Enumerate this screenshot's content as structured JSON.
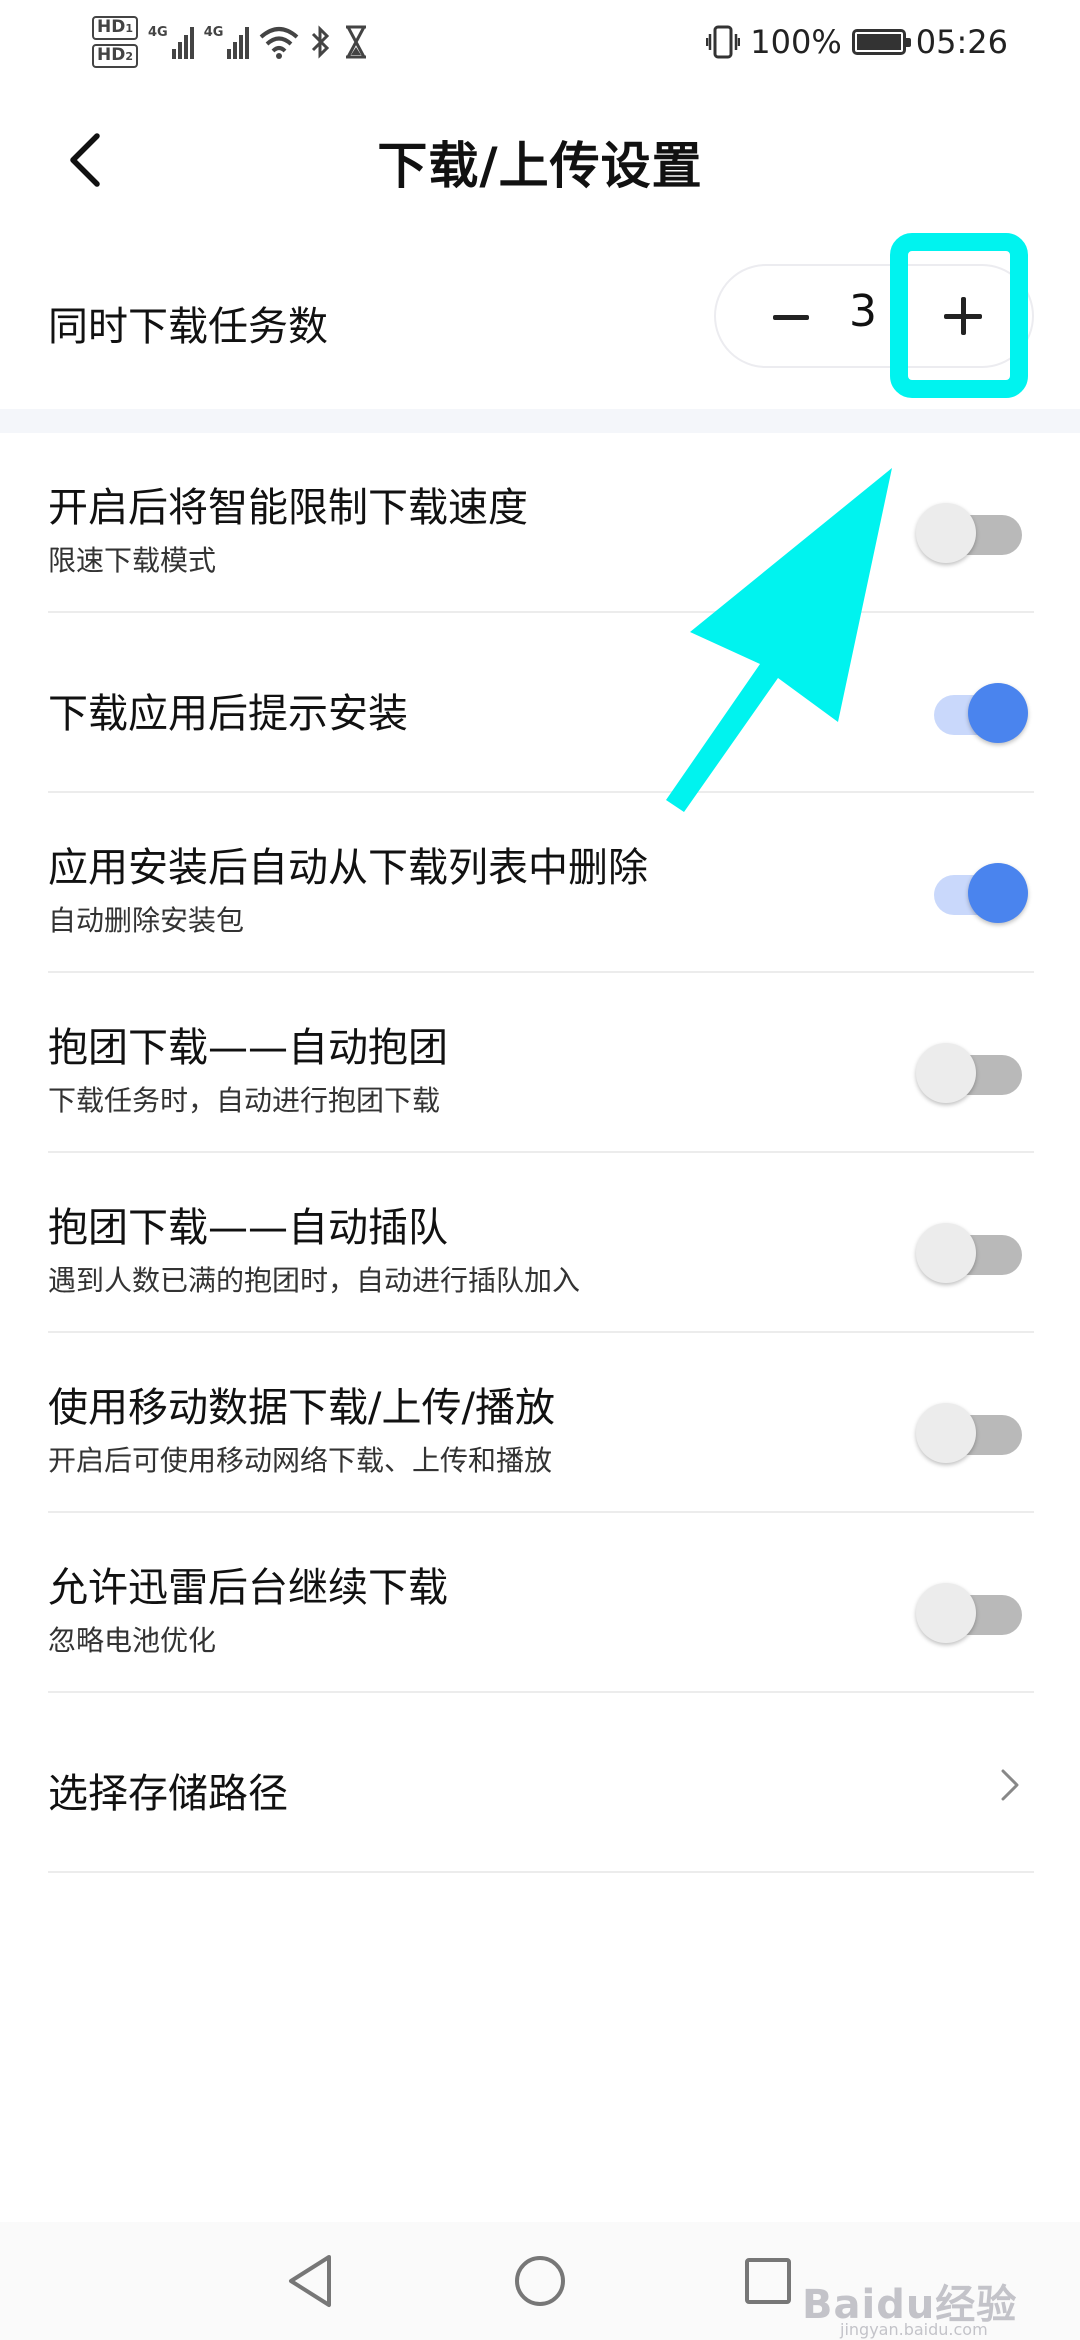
{
  "status_bar": {
    "hd1": "HD",
    "hd1_sub": "1",
    "hd2": "HD",
    "hd2_sub": "2",
    "network1": "4G",
    "network2": "4G",
    "battery_percent": "100%",
    "battery_level": 1.0,
    "time": "05:26",
    "icons": [
      "signal-icon",
      "wifi-icon",
      "bluetooth-icon",
      "hourglass-icon",
      "vibrate-icon",
      "battery-icon"
    ]
  },
  "header": {
    "title": "下载/上传设置",
    "back_icon": "back-arrow-icon"
  },
  "concurrent_tasks": {
    "label": "同时下载任务数",
    "value": "3"
  },
  "settings": [
    {
      "title": "开启后将智能限制下载速度",
      "subtitle": "限速下载模式",
      "enabled": false
    },
    {
      "title": "下载应用后提示安装",
      "subtitle": "",
      "enabled": true
    },
    {
      "title": "应用安装后自动从下载列表中删除",
      "subtitle": "自动删除安装包",
      "enabled": true
    },
    {
      "title": "抱团下载——自动抱团",
      "subtitle": "下载任务时，自动进行抱团下载",
      "enabled": false
    },
    {
      "title": "抱团下载——自动插队",
      "subtitle": "遇到人数已满的抱团时，自动进行插队加入",
      "enabled": false
    },
    {
      "title": "使用移动数据下载/上传/播放",
      "subtitle": "开启后可使用移动网络下载、上传和播放",
      "enabled": false
    },
    {
      "title": "允许迅雷后台继续下载",
      "subtitle": "忽略电池优化",
      "enabled": false
    }
  ],
  "storage": {
    "label": "选择存储路径"
  },
  "colors": {
    "accent": "#4a84ee",
    "accent_track": "#c9d8fb",
    "annotation": "#00f3ef",
    "divider": "#ececec",
    "section_bg": "#f4f6fa"
  },
  "watermark": {
    "text": "Baidu经验",
    "sub": "jingyan.baidu.com"
  }
}
